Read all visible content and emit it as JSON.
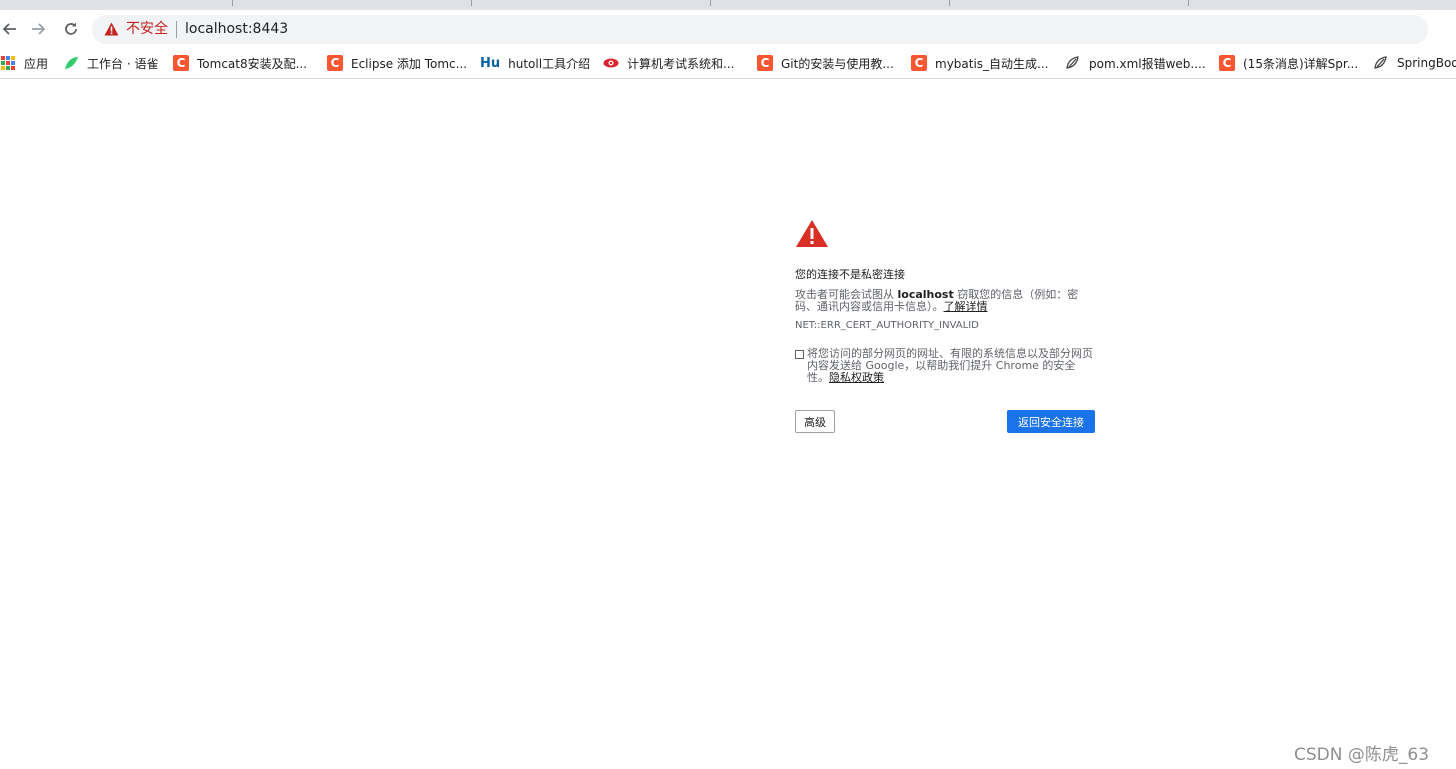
{
  "window": {
    "insecure_label": "不安全",
    "url": "localhost:8443"
  },
  "bookmarks": [
    {
      "label": "应用",
      "icon": "apps-grid-icon"
    },
    {
      "label": "工作台 · 语雀",
      "icon": "yuque-icon"
    },
    {
      "label": "Tomcat8安装及配...",
      "icon": "csdn-icon"
    },
    {
      "label": "Eclipse 添加 Tomc...",
      "icon": "csdn-icon"
    },
    {
      "label": "hutoll工具介绍",
      "icon": "hutool-icon"
    },
    {
      "label": "计算机考试系统和...",
      "icon": "eye-icon"
    },
    {
      "label": "Git的安装与使用教...",
      "icon": "csdn-icon"
    },
    {
      "label": "mybatis_自动生成...",
      "icon": "csdn-icon"
    },
    {
      "label": "pom.xml报错web....",
      "icon": "spring-leaf-icon"
    },
    {
      "label": "(15条消息)详解Spr...",
      "icon": "csdn-icon"
    },
    {
      "label": "SpringBoot",
      "icon": "spring-leaf-icon"
    }
  ],
  "error": {
    "heading": "您的连接不是私密连接",
    "desc_prefix": "攻击者可能会试图从 ",
    "desc_host": "localhost",
    "desc_suffix": " 窃取您的信息（例如：密码、通讯内容或信用卡信息）。",
    "learn_more": "了解详情",
    "code": "NET::ERR_CERT_AUTHORITY_INVALID",
    "consent_text": "将您访问的部分网页的网址、有限的系统信息以及部分网页内容发送给 Google，以帮助我们提升 Chrome 的安全性。",
    "privacy_link": "隐私权政策",
    "advanced_label": "高级",
    "back_label": "返回安全连接"
  },
  "watermark": "CSDN @陈虎_63",
  "colors": {
    "warning_red": "#d93025",
    "primary_blue": "#1a73e8",
    "csdn_orange": "#fc5531"
  }
}
